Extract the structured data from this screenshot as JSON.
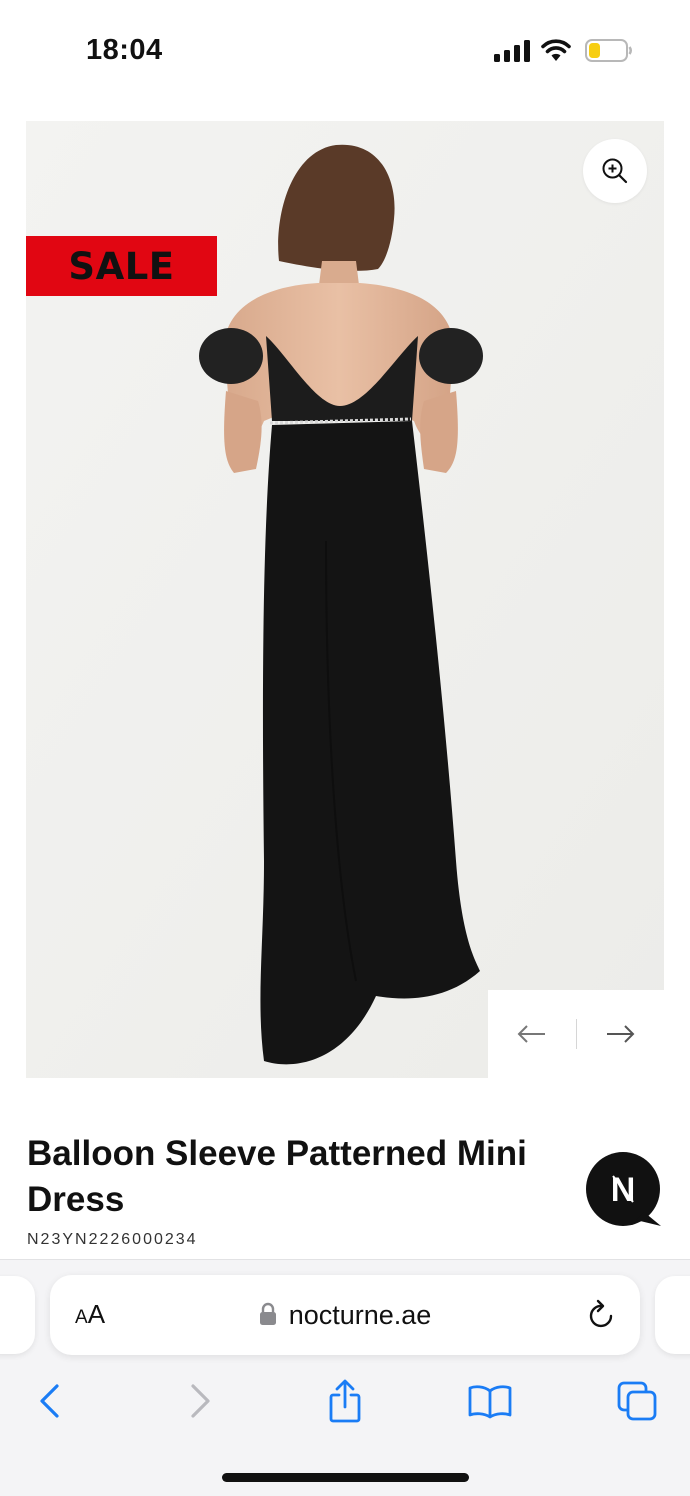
{
  "status_bar": {
    "time": "18:04"
  },
  "product": {
    "badge": "SALE",
    "title": "Balloon Sleeve Patterned Mini Dress",
    "sku": "N23YN2226000234"
  },
  "chat": {
    "logo_text": "N"
  },
  "browser": {
    "aa_small": "A",
    "aa_large": "A",
    "url": "nocturne.ae"
  },
  "colors": {
    "sale_red": "#e10612",
    "safari_blue": "#1a7cf5",
    "battery_yellow": "#f7ce12"
  },
  "icons": [
    "signal-icon",
    "wifi-icon",
    "battery-icon",
    "zoom-in-icon",
    "arrow-left-icon",
    "arrow-right-icon",
    "chat-icon",
    "lock-icon",
    "reload-icon",
    "back-icon",
    "forward-icon",
    "share-icon",
    "bookmarks-icon",
    "tabs-icon"
  ]
}
